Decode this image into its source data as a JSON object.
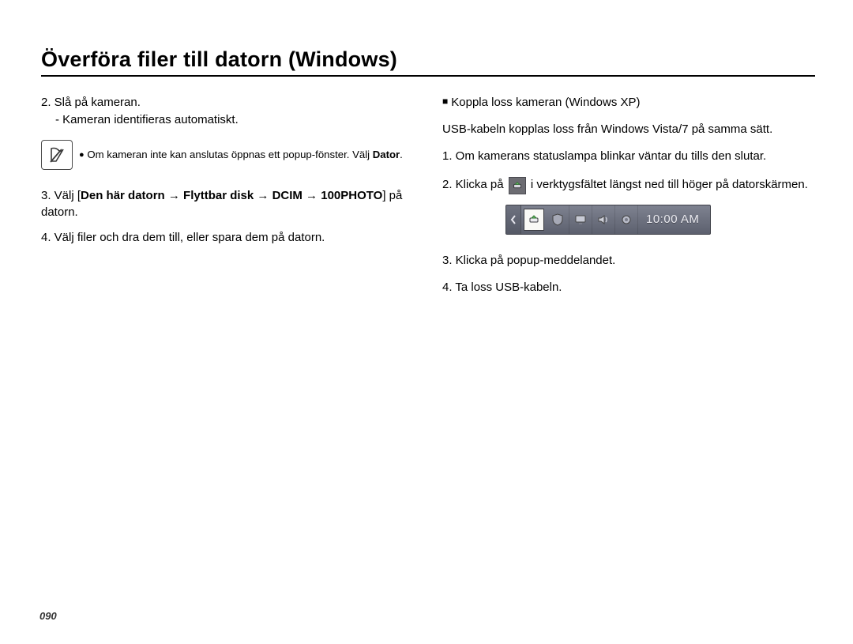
{
  "title": "Överföra filer till datorn (Windows)",
  "left": {
    "step2": "2. Slå på kameran.",
    "step2_sub": "- Kameran identifieras automatiskt.",
    "note_pre": "Om kameran inte kan anslutas öppnas ett popup-fönster. Välj ",
    "note_bold": "Dator",
    "note_post": ".",
    "step3_pre": "3. Välj [",
    "step3_bold": "Den här datorn → Flyttbar disk → DCIM → 100PHOTO",
    "step3_post": "] på datorn.",
    "step4": "4. Välj filer och dra dem till, eller spara dem på datorn."
  },
  "right": {
    "heading": "Koppla loss kameran (Windows XP)",
    "intro": "USB-kabeln kopplas loss från Windows Vista/7 på samma sätt.",
    "step1": "1. Om kamerans statuslampa blinkar väntar du tills den slutar.",
    "step2_pre": "2. Klicka på",
    "step2_post": "i verktygsfältet längst ned till höger på datorskärmen.",
    "taskbar_time": "10:00 AM",
    "step3": "3. Klicka på popup-meddelandet.",
    "step4": "4. Ta loss USB-kabeln."
  },
  "page_number": "090"
}
